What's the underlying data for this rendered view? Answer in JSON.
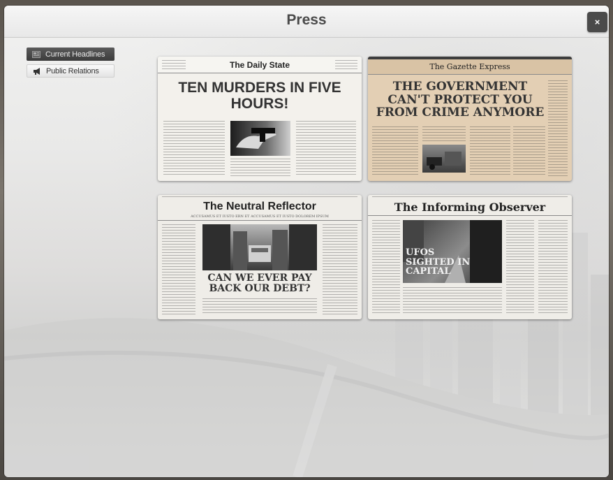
{
  "window": {
    "title": "Press",
    "close_label": "×"
  },
  "menu": {
    "items": [
      {
        "label": "Current Headlines",
        "icon": "newspaper-icon",
        "active": true
      },
      {
        "label": "Public Relations",
        "icon": "megaphone-icon",
        "active": false
      }
    ]
  },
  "papers": [
    {
      "masthead": "The Daily State",
      "headline": "TEN MURDERS IN FIVE HOURS!",
      "image": "gun-photo"
    },
    {
      "masthead": "The Gazette Express",
      "headline": "THE GOVERNMENT CAN'T PROTECT YOU FROM CRIME ANYMORE",
      "image": "crime-scene-photo"
    },
    {
      "masthead": "The Neutral Reflector",
      "subtitle": "ACCUSAMUS ET IUSTO ERN ET ACCUSAMUS ET IUSTO DOLOREM IPSUM",
      "headline": "CAN WE EVER PAY BACK OUR DEBT?",
      "image": "city-street-photo"
    },
    {
      "masthead": "The Informing Observer",
      "headline": "UFOS SIGHTED IN CAPITAL",
      "image": "foggy-street-photo"
    }
  ],
  "colors": {
    "accent": "#4a4a4a",
    "menu_active": "#3c3c3c",
    "gazette_paper": "#e3cfb4",
    "paper": "#efede8"
  }
}
